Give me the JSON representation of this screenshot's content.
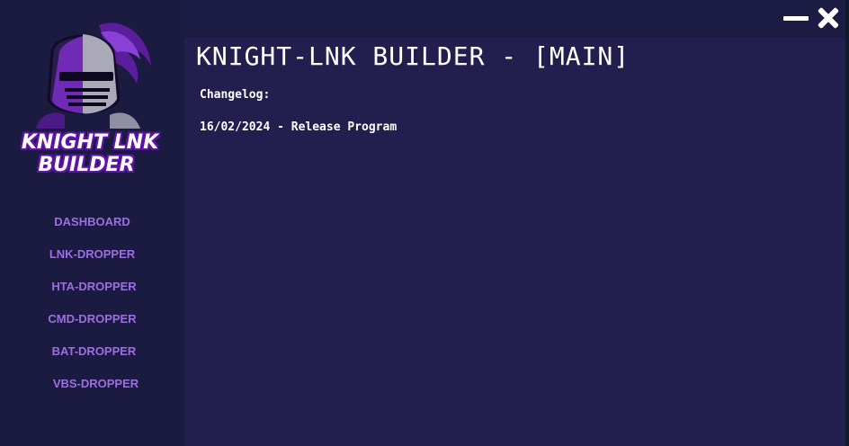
{
  "window": {
    "title": "KNIGHT-LNK BUILDER - [MAIN]"
  },
  "logo": {
    "line1": "KNIGHT LNK",
    "line2": "BUILDER"
  },
  "sidebar": {
    "items": [
      {
        "label": "DASHBOARD"
      },
      {
        "label": "LNK-DROPPER"
      },
      {
        "label": "HTA-DROPPER"
      },
      {
        "label": "CMD-DROPPER"
      },
      {
        "label": "BAT-DROPPER"
      },
      {
        "label": "VBS-DROPPER"
      }
    ]
  },
  "main": {
    "changelog_label": "Changelog:",
    "changelog_entry": "16/02/2024 - Release Program"
  },
  "colors": {
    "background": "#221f4f",
    "sidebar": "#1b1a40",
    "titlebar": "#1c1b44",
    "nav_text": "#9b6fe0",
    "logo_accent": "#6a0fb0",
    "text": "#ffffff"
  },
  "icons": {
    "minimize": "minimize-icon",
    "close": "close-icon",
    "logo": "knight-helmet-icon"
  }
}
